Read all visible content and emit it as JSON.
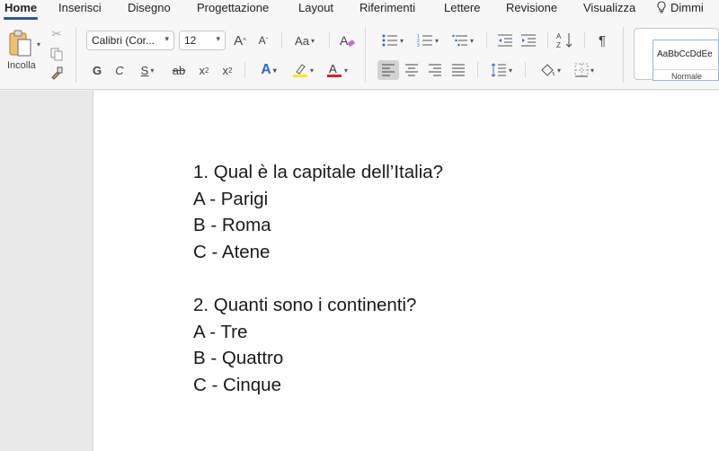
{
  "tabs": [
    "Home",
    "Inserisci",
    "Disegno",
    "Progettazione",
    "Layout",
    "Riferimenti",
    "Lettere",
    "Revisione",
    "Visualizza"
  ],
  "tell_me": "Dimmi",
  "clipboard": {
    "paste_label": "Incolla"
  },
  "font": {
    "name": "Calibri (Cor...",
    "size": "12"
  },
  "format_glyphs": {
    "bold": "G",
    "italic": "C",
    "underline": "S",
    "strike": "ab",
    "sub": "x",
    "sup": "x",
    "grow": "A",
    "shrink": "A",
    "case": "Aa",
    "text_effects": "A",
    "font_color": "A"
  },
  "colors": {
    "accent": "#2b579a",
    "highlight": "#f6e71d",
    "font_color": "#e02020"
  },
  "styles": {
    "sample": "AaBbCcDdEe",
    "name": "Normale"
  },
  "document": {
    "lines": [
      "1. Qual è la capitale dell’Italia?",
      "A - Parigi",
      "B - Roma",
      "C - Atene",
      "2. Quanti sono i continenti?",
      "A - Tre",
      "B - Quattro",
      "C - Cinque"
    ]
  }
}
